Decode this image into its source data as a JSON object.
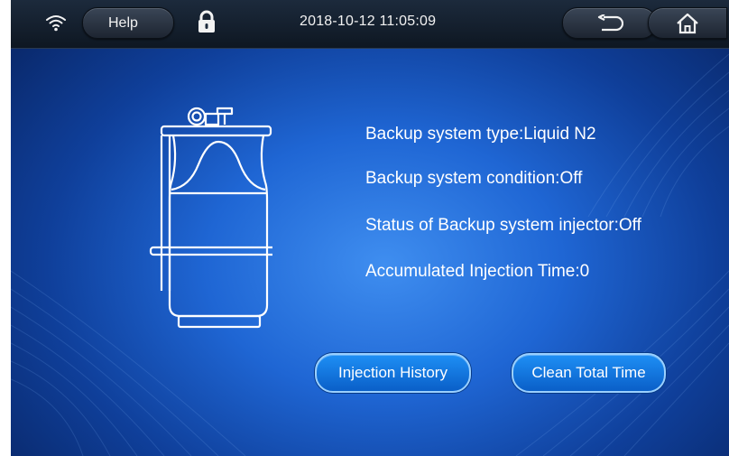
{
  "statusbar": {
    "help_label": "Help",
    "datetime": "2018-10-12 11:05:09",
    "icons": [
      "wifi-icon",
      "lock-icon",
      "back-icon",
      "home-icon"
    ]
  },
  "backup": {
    "type_line": "Backup system type:Liquid N2",
    "condition_line": "Backup system condition:Off",
    "injector_line": "Status of Backup system injector:Off",
    "time_line": "Accumulated Injection Time:0",
    "illustration": "gas-cylinder-icon"
  },
  "actions": {
    "injection_history_label": "Injection History",
    "clean_total_time_label": "Clean Total Time"
  },
  "colors": {
    "background_center": "#3f8ef0",
    "background_edge": "#0a2a6e",
    "statusbar": "#1c2a3c",
    "button": "#1e8ff5",
    "text": "#ffffff"
  }
}
